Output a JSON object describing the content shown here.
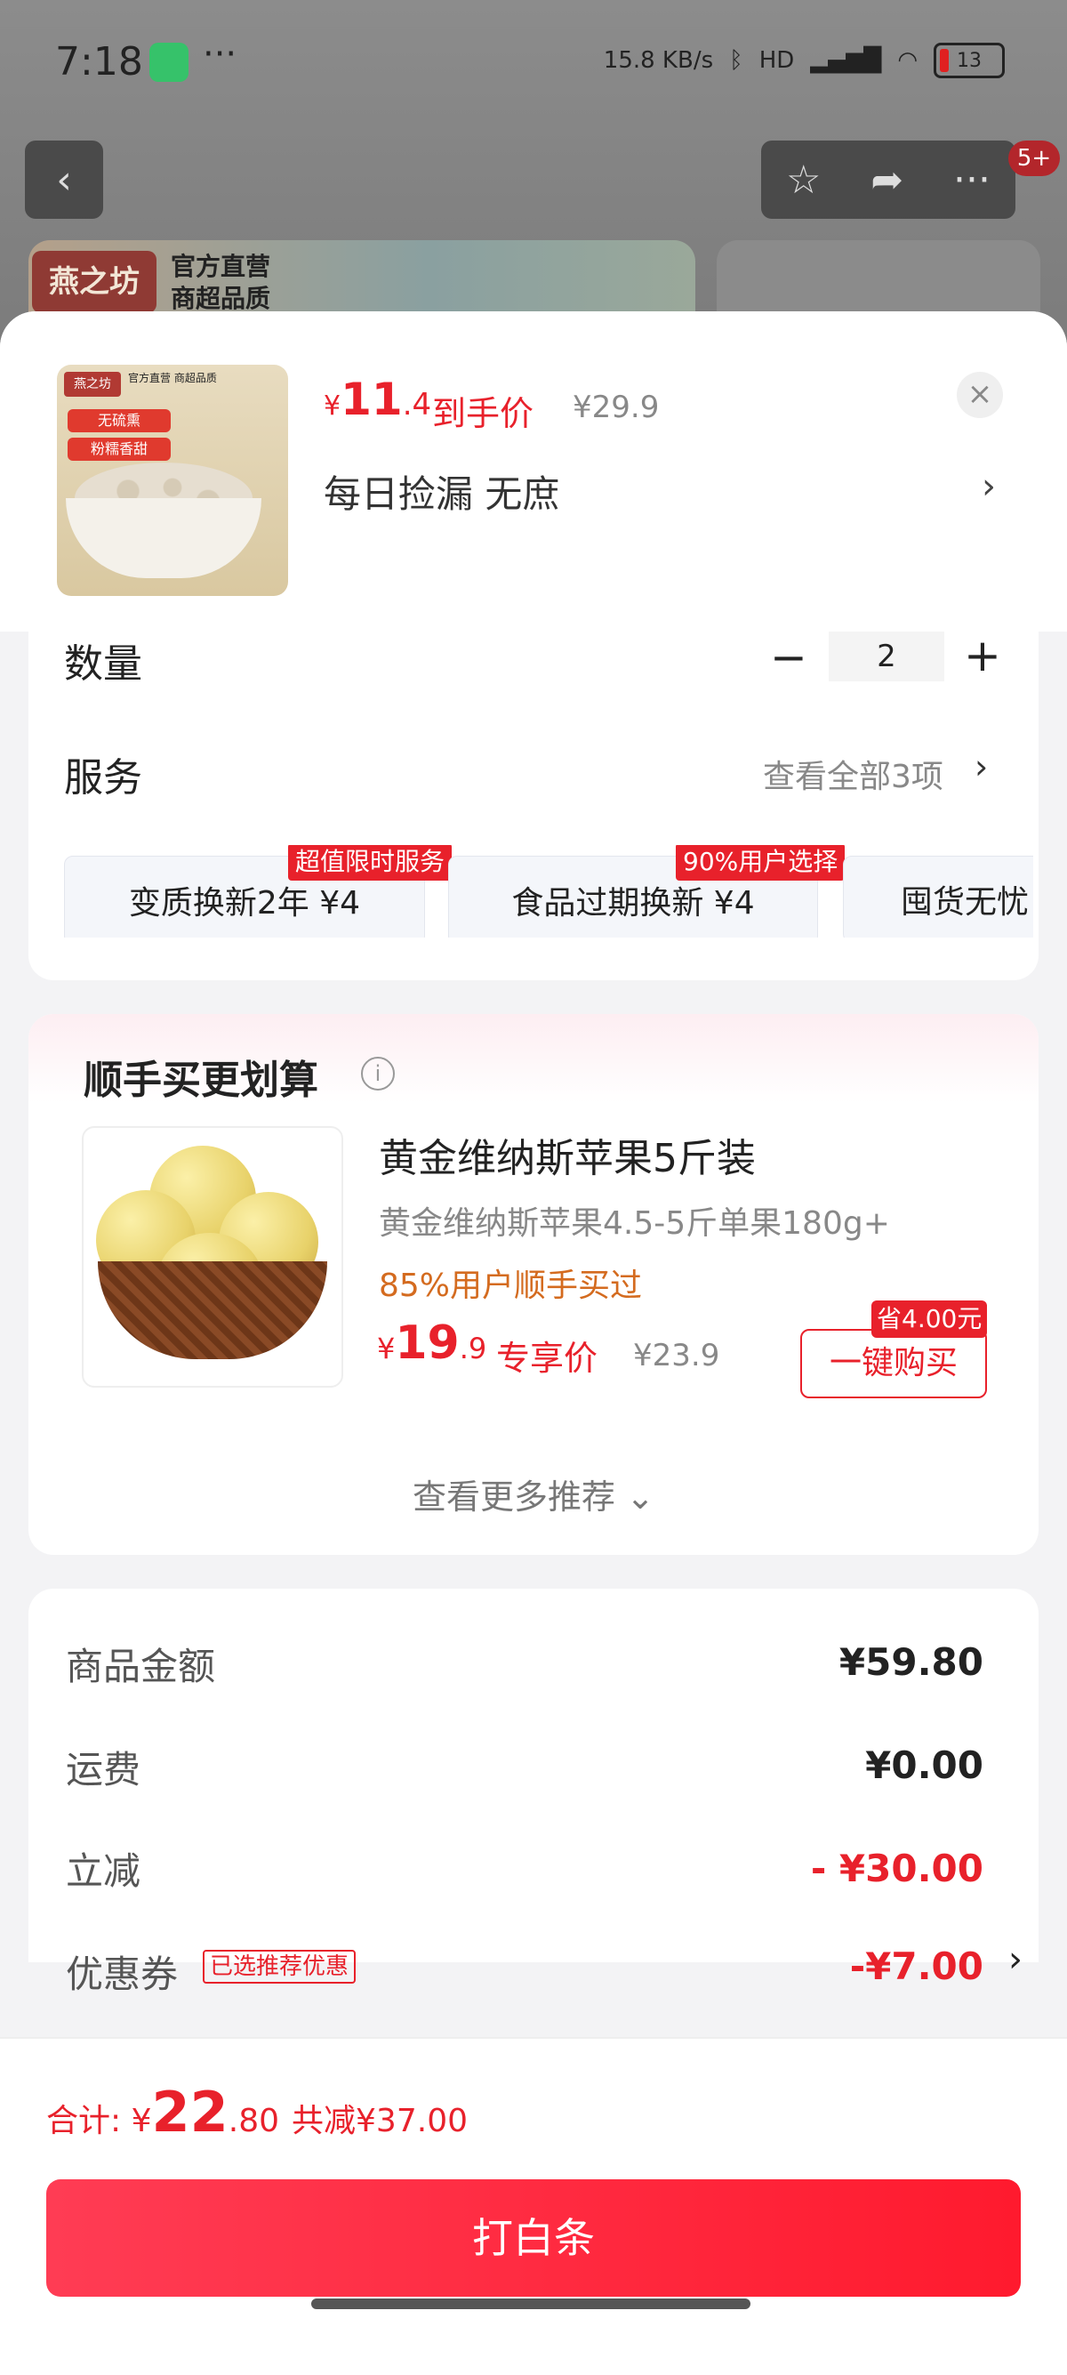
{
  "status_bar": {
    "time": "7:18",
    "more": "···",
    "net_speed": "15.8 KB/s",
    "signal": "HD",
    "battery": "13"
  },
  "background": {
    "back_icon": "chevron-left-icon",
    "notification_badge": "5+",
    "brand_logo_text": "燕之坊",
    "brand_line1": "官方直营",
    "brand_line2": "商超品质"
  },
  "product": {
    "thumb_logo": "燕之坊",
    "thumb_sub": "官方直营 商超品质",
    "thumb_tag1": "无硫熏",
    "thumb_tag2": "粉糯香甜",
    "currency": "¥",
    "price_int": "11",
    "price_dec": ".4",
    "price_tag": "到手价",
    "price_old": "¥29.9",
    "spec_text": "每日捡漏  无庶",
    "spec_arrow": "›",
    "close": "×"
  },
  "quantity": {
    "label": "数量",
    "minus": "−",
    "value": "2",
    "plus": "+"
  },
  "services": {
    "label": "服务",
    "view_all": "查看全部3项",
    "arrow": "›",
    "items": [
      {
        "label": "变质换新2年  ¥4",
        "badge": "超值限时服务"
      },
      {
        "label": "食品过期换新  ¥4",
        "badge": "90%用户选择"
      },
      {
        "label": "囤货无忧",
        "badge": ""
      }
    ]
  },
  "recommend": {
    "title": "顺手买更划算",
    "info_icon": "i",
    "name": "黄金维纳斯苹果5斤装",
    "desc": "黄金维纳斯苹果4.5-5斤单果180g+",
    "bought": "85%用户顺手买过",
    "currency": "¥",
    "price_int": "19",
    "price_dec": ".9",
    "price_tag": "专享价",
    "price_old": "¥23.9",
    "save_badge": "省4.00元",
    "buy_button": "一键购买",
    "more": "查看更多推荐 ⌄"
  },
  "summary": {
    "rows": [
      {
        "label": "商品金额",
        "value": "¥59.80"
      },
      {
        "label": "运费",
        "value": "¥0.00"
      },
      {
        "label": "立减",
        "value": "- ¥30.00"
      },
      {
        "label": "优惠券",
        "value": "-¥7.00"
      }
    ],
    "coupon_tag": "已选推荐优惠",
    "coupon_arrow": "›"
  },
  "checkout": {
    "total_label": "合计: ",
    "currency": "¥",
    "total_int": "22",
    "total_dec": ".80",
    "saved": "共减¥37.00",
    "pay_button": "打白条"
  },
  "colors": {
    "accent_red": "#e8212b",
    "orange_text": "#d46b1f"
  }
}
